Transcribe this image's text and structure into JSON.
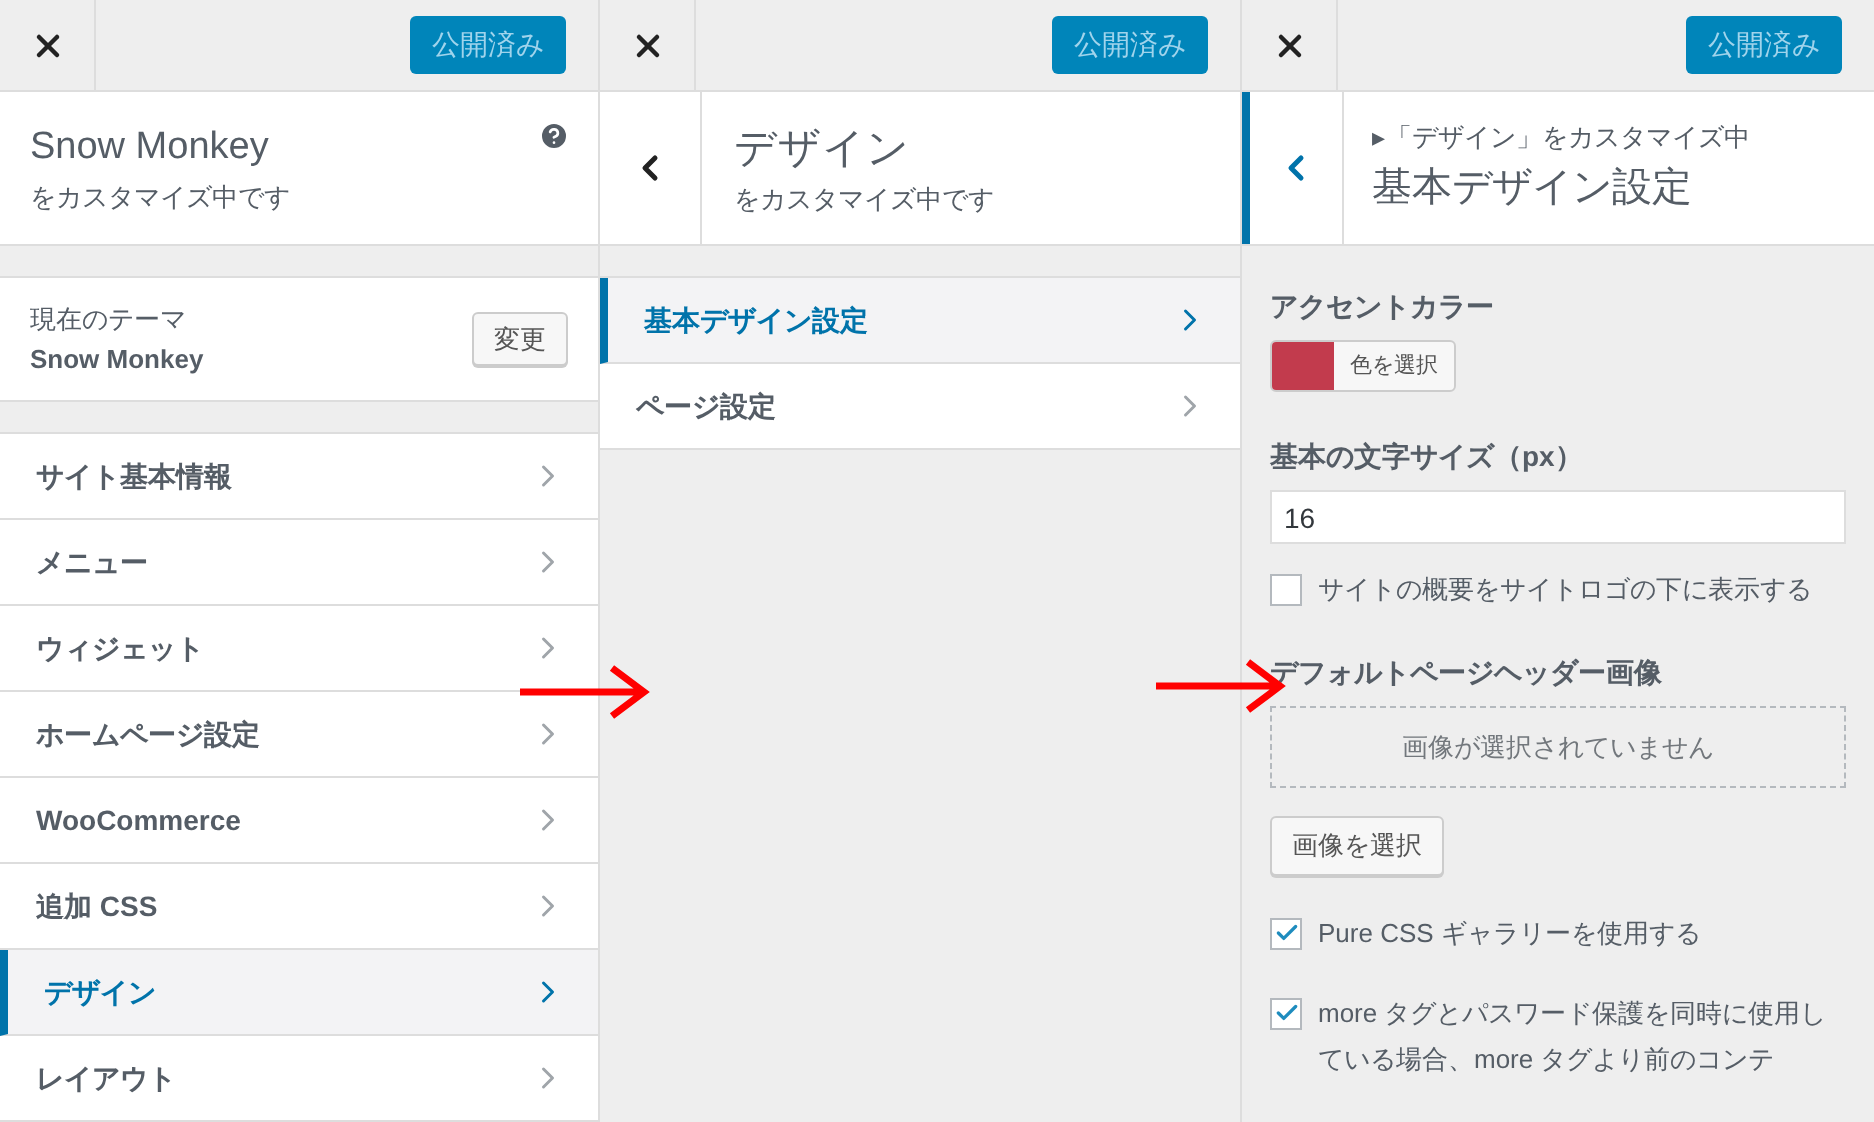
{
  "main_panel": {
    "publish_button": "公開済み",
    "title": "Snow Monkey",
    "subtitle": "をカスタマイズ中です",
    "theme": {
      "label": "現在のテーマ",
      "name": "Snow Monkey",
      "change_button": "変更"
    },
    "sections": [
      {
        "label": "サイト基本情報",
        "selected": false
      },
      {
        "label": "メニュー",
        "selected": false
      },
      {
        "label": "ウィジェット",
        "selected": false
      },
      {
        "label": "ホームページ設定",
        "selected": false
      },
      {
        "label": "WooCommerce",
        "selected": false
      },
      {
        "label": "追加 CSS",
        "selected": false
      },
      {
        "label": "デザイン",
        "selected": true
      },
      {
        "label": "レイアウト",
        "selected": false
      }
    ]
  },
  "design_panel": {
    "publish_button": "公開済み",
    "title": "デザイン",
    "subtitle": "をカスタマイズ中です",
    "sections": [
      {
        "label": "基本デザイン設定",
        "selected": true
      },
      {
        "label": "ページ設定",
        "selected": false
      }
    ]
  },
  "basic_design_panel": {
    "publish_button": "公開済み",
    "breadcrumb": "▸「デザイン」をカスタマイズ中",
    "title": "基本デザイン設定",
    "controls": [
      {
        "kind": "color",
        "label": "アクセントカラー",
        "color": "#c23b4d",
        "button": "色を選択"
      },
      {
        "kind": "number",
        "label": "基本の文字サイズ（px）",
        "value": "16"
      },
      {
        "kind": "checkbox",
        "label": "サイトの概要をサイトロゴの下に表示する",
        "checked": false
      },
      {
        "kind": "image",
        "label": "デフォルトページヘッダー画像",
        "placeholder": "画像が選択されていません",
        "button": "画像を選択"
      },
      {
        "kind": "checkbox",
        "label": "Pure CSS ギャラリーを使用する",
        "checked": true
      },
      {
        "kind": "checkbox",
        "label": "more タグとパスワード保護を同時に使用している場合、more タグより前のコンテ",
        "checked": true
      }
    ]
  }
}
